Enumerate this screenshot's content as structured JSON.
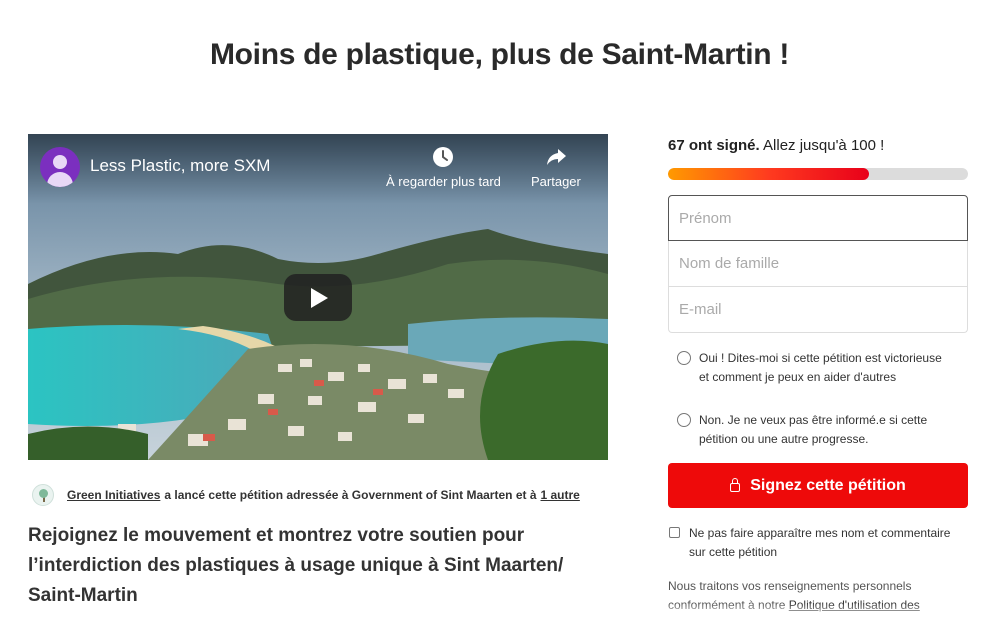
{
  "page": {
    "title": "Moins de plastique, plus de Saint-Martin !",
    "subtitle": "Rejoignez le mouvement et montrez votre soutien pour l’interdiction des plastiques à usage unique à Sint Maarten/ Saint-Martin"
  },
  "video": {
    "title": "Less Plastic, more SXM",
    "watch_later_label": "À regarder plus tard",
    "share_label": "Partager"
  },
  "starter": {
    "org_name": "Green Initiatives",
    "text": "a lancé cette pétition adressée à Government of Sint Maarten et à",
    "others_link": "1 autre"
  },
  "signatures": {
    "count_label": "67 ont signé.",
    "goal_label": "Allez jusqu'à 100 !",
    "progress_fraction": 0.67
  },
  "form": {
    "first_name_placeholder": "Prénom",
    "last_name_placeholder": "Nom de famille",
    "email_placeholder": "E-mail",
    "option_yes": "Oui ! Dites-moi si cette pétition est victorieuse et comment je peux en aider d'autres",
    "option_no": "Non. Je ne veux pas être informé.e si cette pétition ou une autre progresse.",
    "sign_button": "Signez cette pétition",
    "hide_name_label": "Ne pas faire apparaître mes nom et commentaire sur cette pétition",
    "privacy_text": "Nous traitons vos renseignements personnels conformément à notre",
    "privacy_link": "Politique d'utilisation des"
  },
  "colors": {
    "accent": "#ee0a0a",
    "progress_start": "#ff9a00",
    "progress_end": "#e8001a"
  }
}
